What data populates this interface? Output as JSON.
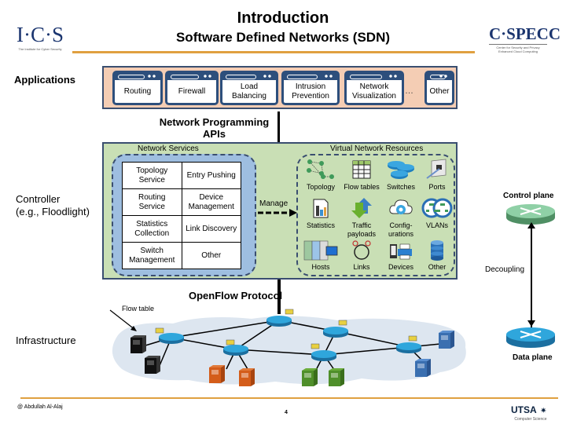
{
  "header": {
    "title": "Introduction",
    "subtitle": "Software Defined Networks (SDN)",
    "left_logo": {
      "mark": "I·C·S",
      "sub": "The Institute for Cyber Security"
    },
    "right_logo": {
      "mark": "C·SPECC",
      "sub": "Center for Security and Privacy Enhanced Cloud Computing"
    }
  },
  "layers": {
    "applications": "Applications",
    "controller": "Controller\n(e.g., Floodlight)",
    "infrastructure": "Infrastructure"
  },
  "applications": {
    "items": [
      "Routing",
      "Firewall",
      "Load Balancing",
      "Intrusion Prevention",
      "Network Visualization",
      "Other"
    ],
    "ellipsis": "…"
  },
  "apis_label": "Network Programming APIs",
  "network_services": {
    "title": "Network Services",
    "rows": [
      [
        "Topology Service",
        "Entry Pushing"
      ],
      [
        "Routing Service",
        "Device Management"
      ],
      [
        "Statistics Collection",
        "Link Discovery"
      ],
      [
        "Switch Management",
        "Other"
      ]
    ],
    "manage_label": "Manage"
  },
  "virtual_resources": {
    "title": "Virtual Network Resources",
    "items": [
      {
        "label": "Topology",
        "icon": "topology-icon"
      },
      {
        "label": "Flow tables",
        "icon": "flow-table-icon"
      },
      {
        "label": "Switches",
        "icon": "switches-icon"
      },
      {
        "label": "Ports",
        "icon": "ports-icon"
      },
      {
        "label": "Statistics",
        "icon": "statistics-icon"
      },
      {
        "label": "Traffic payloads",
        "icon": "traffic-icon"
      },
      {
        "label": "Config-urations",
        "icon": "configuration-icon"
      },
      {
        "label": "VLANs",
        "icon": "vlan-icon"
      },
      {
        "label": "Hosts",
        "icon": "hosts-icon"
      },
      {
        "label": "Links",
        "icon": "links-icon"
      },
      {
        "label": "Devices",
        "icon": "devices-icon"
      },
      {
        "label": "Other",
        "icon": "database-icon"
      }
    ]
  },
  "planes": {
    "control": "Control plane",
    "decoupling": "Decoupling",
    "data": "Data plane"
  },
  "infrastructure": {
    "protocol_label": "OpenFlow Protocol",
    "flow_table_label": "Flow table"
  },
  "footer": {
    "author": "@ Abdullah Al-Alaj",
    "page": "4",
    "logo": {
      "mark": "UTSA",
      "sub": "Computer Science"
    }
  },
  "colors": {
    "accent_rule": "#e0a040",
    "apps_band": "#f4cdb4",
    "controller_band": "#c9dfb5",
    "services_panel": "#9ebee0",
    "frame": "#3a4e70",
    "router_blue": "#1e8fc8",
    "router_green": "#5fae7a"
  }
}
